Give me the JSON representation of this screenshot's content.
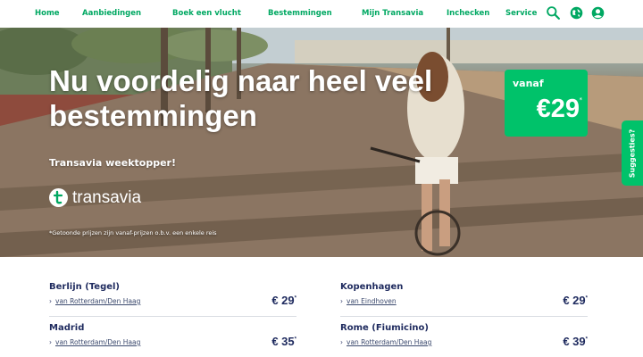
{
  "nav": {
    "items": [
      "Home",
      "Aanbiedingen",
      "Boek een vlucht",
      "Bestemmingen",
      "Mijn Transavia",
      "Inchecken",
      "Service"
    ],
    "icons": [
      "search-icon",
      "globe-icon",
      "account-icon"
    ]
  },
  "hero": {
    "title": "Nu voordelig naar heel veel bestemmingen",
    "subtitle": "Transavia weektopper!",
    "logo_text": "transavia",
    "disclaimer": "*Getoonde prijzen zijn vanaf-prijzen o.b.v. een enkele reis"
  },
  "badge": {
    "from": "vanaf",
    "price": "€29",
    "star": "*"
  },
  "suggest": {
    "label": "Suggesties?"
  },
  "deals": [
    {
      "dest": "Berlijn (Tegel)",
      "link": "van Rotterdam/Den Haag",
      "price": "€ 29",
      "star": "*"
    },
    {
      "dest": "Kopenhagen",
      "link": "van Eindhoven",
      "price": "€ 29",
      "star": "*"
    },
    {
      "dest": "Madrid",
      "link": "van Rotterdam/Den Haag",
      "price": "€ 35",
      "star": "*"
    },
    {
      "dest": "Rome (Fiumicino)",
      "link": "van Rotterdam/Den Haag",
      "price": "€ 39",
      "star": "*"
    }
  ],
  "colors": {
    "brand_green": "#00a862",
    "badge_green": "#00c26a",
    "navy_text": "#1e2a5e"
  }
}
